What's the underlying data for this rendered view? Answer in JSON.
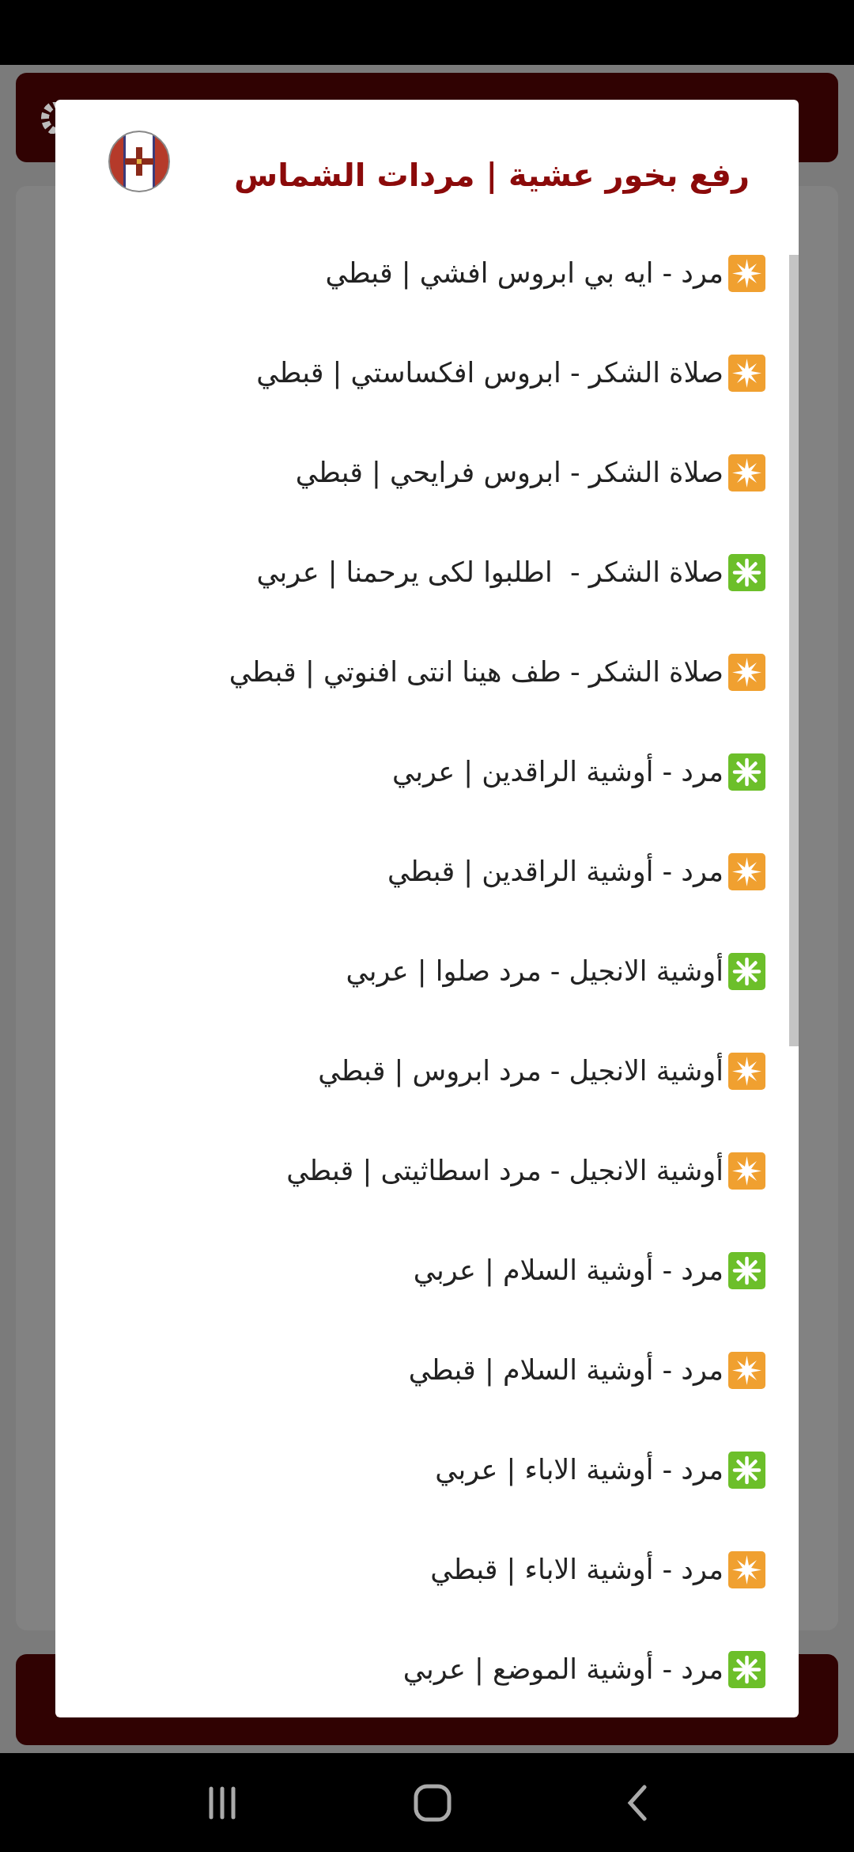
{
  "dialog": {
    "title": "رفع بخور عشية | مردات الشماس",
    "items": [
      {
        "kind": "star",
        "label": "مرد - ايه بي ابروس افشي | قبطي"
      },
      {
        "kind": "star",
        "label": "صلاة الشكر - ابروس افكساستي | قبطي"
      },
      {
        "kind": "star",
        "label": "صلاة الشكر - ابروس فرايحي | قبطي"
      },
      {
        "kind": "asterisk",
        "label": "صلاة الشكر -  اطلبوا لكى يرحمنا | عربي"
      },
      {
        "kind": "star",
        "label": "صلاة الشكر - طف هينا انتى افنوتي | قبطي"
      },
      {
        "kind": "asterisk",
        "label": "مرد - أوشية الراقدين | عربي"
      },
      {
        "kind": "star",
        "label": "مرد - أوشية الراقدين | قبطي"
      },
      {
        "kind": "asterisk",
        "label": "أوشية الانجيل - مرد صلوا | عربي"
      },
      {
        "kind": "star",
        "label": "أوشية الانجيل - مرد ابروس | قبطي"
      },
      {
        "kind": "star",
        "label": "أوشية الانجيل - مرد اسطاثيتى | قبطي"
      },
      {
        "kind": "asterisk",
        "label": "مرد - أوشية السلام | عربي"
      },
      {
        "kind": "star",
        "label": "مرد - أوشية السلام | قبطي"
      },
      {
        "kind": "asterisk",
        "label": "مرد - أوشية الاباء | عربي"
      },
      {
        "kind": "star",
        "label": "مرد - أوشية الاباء | قبطي"
      },
      {
        "kind": "asterisk",
        "label": "مرد - أوشية الموضع | عربي"
      }
    ]
  }
}
